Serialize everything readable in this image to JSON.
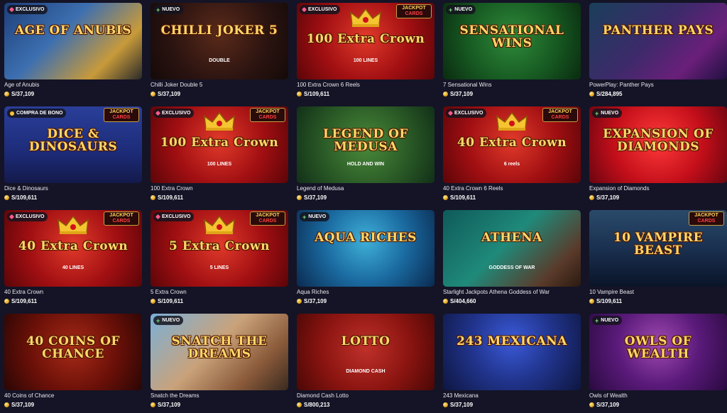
{
  "games": [
    {
      "name": "Age of Anubis",
      "amount": "S/37,109",
      "badge": "EXCLUSIVO",
      "badge_type": "excl",
      "jackpot": false,
      "art_title": "AGE OF ANUBIS",
      "art_sub": "",
      "bg": "linear-gradient(135deg,#1d3f7a 0%,#3d6fb0 40%,#c89a3a 75%,#2a2a2a 100%)"
    },
    {
      "name": "Chilli Joker Double 5",
      "amount": "S/37,109",
      "badge": "NUEVO",
      "badge_type": "new",
      "jackpot": false,
      "art_title": "CHILLI JOKER 5",
      "art_sub": "DOUBLE",
      "bg": "radial-gradient(circle at 50% 40%,#5a2a1a 0%,#2a1310 60%,#140a08 100%)"
    },
    {
      "name": "100 Extra Crown 6 Reels",
      "amount": "S/109,611",
      "badge": "EXCLUSIVO",
      "badge_type": "excl",
      "jackpot": true,
      "art_title": "100 Extra Crown",
      "art_sub": "100 LINES",
      "bg": "radial-gradient(circle at 50% 45%,#e13a2a 0%,#a10f12 55%,#5b0508 100%)"
    },
    {
      "name": "7 Sensational Wins",
      "amount": "S/37,109",
      "badge": "NUEVO",
      "badge_type": "new",
      "jackpot": false,
      "art_title": "SENSATIONAL WINS",
      "art_sub": "",
      "bg": "radial-gradient(circle at 50% 45%,#2f8a3a 0%,#175a22 55%,#0a2b10 100%)"
    },
    {
      "name": "PowerPlay: Panther Pays",
      "amount": "S/284,895",
      "badge": "",
      "badge_type": "",
      "jackpot": false,
      "art_title": "PANTHER PAYS",
      "art_sub": "",
      "bg": "linear-gradient(135deg,#1a3f5a 0%,#3c2a6a 45%,#6a1f7a 75%,#201040 100%)"
    },
    {
      "name": "Dice & Dinosaurs",
      "amount": "S/109,611",
      "badge": "COMPRA DE BONO",
      "badge_type": "bono",
      "jackpot": true,
      "art_title": "DICE & DINOSAURS",
      "art_sub": "",
      "bg": "linear-gradient(180deg,#2a3f9a 0%,#1d2b78 60%,#131a4a 100%)"
    },
    {
      "name": "100 Extra Crown",
      "amount": "S/109,611",
      "badge": "EXCLUSIVO",
      "badge_type": "excl",
      "jackpot": true,
      "art_title": "100 Extra Crown",
      "art_sub": "100 LINES",
      "bg": "radial-gradient(circle at 50% 45%,#e13a2a 0%,#a10f12 55%,#5b0508 100%)"
    },
    {
      "name": "Legend of Medusa",
      "amount": "S/37,109",
      "badge": "",
      "badge_type": "",
      "jackpot": false,
      "art_title": "LEGEND OF MEDUSA",
      "art_sub": "HOLD AND WIN",
      "bg": "radial-gradient(circle at 50% 50%,#4a8a3a 0%,#2a5a26 55%,#123018 100%)"
    },
    {
      "name": "40 Extra Crown 6 Reels",
      "amount": "S/109,611",
      "badge": "EXCLUSIVO",
      "badge_type": "excl",
      "jackpot": true,
      "art_title": "40 Extra Crown",
      "art_sub": "6 reels",
      "bg": "radial-gradient(circle at 50% 45%,#e13a2a 0%,#a10f12 55%,#5b0508 100%)"
    },
    {
      "name": "Expansion of Diamonds",
      "amount": "S/37,109",
      "badge": "NUEVO",
      "badge_type": "new",
      "jackpot": false,
      "art_title": "EXPANSION OF DIAMONDS",
      "art_sub": "",
      "bg": "radial-gradient(circle at 50% 45%,#ff3a3a 0%,#c40f1a 55%,#6a0510 100%)"
    },
    {
      "name": "40 Extra Crown",
      "amount": "S/109,611",
      "badge": "EXCLUSIVO",
      "badge_type": "excl",
      "jackpot": true,
      "art_title": "40 Extra Crown",
      "art_sub": "40 LINES",
      "bg": "radial-gradient(circle at 50% 45%,#e13a2a 0%,#a10f12 55%,#5b0508 100%)"
    },
    {
      "name": "5 Extra Crown",
      "amount": "S/109,611",
      "badge": "EXCLUSIVO",
      "badge_type": "excl",
      "jackpot": true,
      "art_title": "5 Extra Crown",
      "art_sub": "5 LINES",
      "bg": "radial-gradient(circle at 50% 45%,#e13a2a 0%,#a10f12 55%,#5b0508 100%)"
    },
    {
      "name": "Aqua Riches",
      "amount": "S/37,109",
      "badge": "NUEVO",
      "badge_type": "new",
      "jackpot": false,
      "art_title": "AQUA RICHES",
      "art_sub": "",
      "bg": "radial-gradient(circle at 50% 40%,#3fb0d8 0%,#1a6aa0 50%,#0a2a50 100%)"
    },
    {
      "name": "Starlight Jackpots Athena Goddess of War",
      "amount": "S/404,660",
      "badge": "",
      "badge_type": "",
      "jackpot": false,
      "art_title": "ATHENA",
      "art_sub": "GODDESS OF WAR",
      "bg": "linear-gradient(135deg,#0f5a5a 0%,#1f8a7a 45%,#5a3a2a 80%,#2a1a10 100%)"
    },
    {
      "name": "10 Vampire Beast",
      "amount": "S/109,611",
      "badge": "",
      "badge_type": "",
      "jackpot": true,
      "art_title": "10 VAMPIRE BEAST",
      "art_sub": "",
      "bg": "linear-gradient(180deg,#2a4a6a 0%,#1a3050 50%,#0a1428 100%)"
    },
    {
      "name": "40 Coins of Chance",
      "amount": "S/37,109",
      "badge": "",
      "badge_type": "",
      "jackpot": false,
      "art_title": "40 COINS OF CHANCE",
      "art_sub": "",
      "bg": "radial-gradient(circle at 50% 45%,#a82a18 0%,#6a1008 55%,#2a0604 100%)"
    },
    {
      "name": "Snatch the Dreams",
      "amount": "S/37,109",
      "badge": "NUEVO",
      "badge_type": "new",
      "jackpot": false,
      "art_title": "SNATCH THE DREAMS",
      "art_sub": "",
      "bg": "linear-gradient(135deg,#7ab0d8 0%,#c9a27a 45%,#8a5a3a 75%,#3a2a20 100%)"
    },
    {
      "name": "Diamond Cash Lotto",
      "amount": "S/800,213",
      "badge": "",
      "badge_type": "",
      "jackpot": false,
      "art_title": "LOTTO",
      "art_sub": "DIAMOND CASH",
      "bg": "radial-gradient(circle at 50% 45%,#c0302a 0%,#8a1410 55%,#4a0806 100%)"
    },
    {
      "name": "243 Mexicana",
      "amount": "S/37,109",
      "badge": "",
      "badge_type": "",
      "jackpot": false,
      "art_title": "243 MEXICANA",
      "art_sub": "",
      "bg": "radial-gradient(circle at 50% 35%,#3a5ad8 0%,#20338a 50%,#0e1640 100%)"
    },
    {
      "name": "Owls of Wealth",
      "amount": "S/37,109",
      "badge": "NUEVO",
      "badge_type": "new",
      "jackpot": false,
      "art_title": "OWLS OF WEALTH",
      "art_sub": "",
      "bg": "radial-gradient(circle at 50% 40%,#a04ab0 0%,#5a1a7a 50%,#2a0a40 100%)"
    }
  ],
  "jackpot_label_top": "JACKPOT",
  "jackpot_label_bottom": "CARDS",
  "colors": {
    "background": "#141426",
    "badge_excl": "#ff5a8a",
    "badge_new": "#7ee27e",
    "coin": "#e0a418"
  }
}
